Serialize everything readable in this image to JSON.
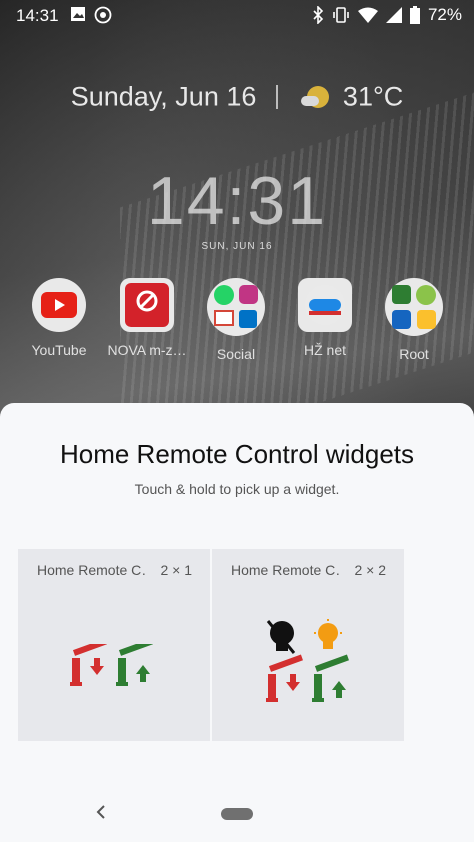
{
  "status_bar": {
    "time": "14:31",
    "battery": "72%",
    "left_icons": [
      "image-icon",
      "whatsapp-icon"
    ],
    "right_icons": [
      "bluetooth-icon",
      "vibrate-icon",
      "wifi-icon",
      "signal-icon",
      "battery-icon"
    ]
  },
  "home": {
    "date": "Sunday, Jun 16",
    "temperature": "31°C",
    "clock_time": "14:31",
    "clock_date": "SUN, JUN 16",
    "apps": [
      {
        "label": "YouTube",
        "icon": "youtube-icon"
      },
      {
        "label": "NOVA m-z…",
        "icon": "nova-icon"
      },
      {
        "label": "Social",
        "icon": "social-folder-icon"
      },
      {
        "label": "HŽ net",
        "icon": "train-icon"
      },
      {
        "label": "Root",
        "icon": "root-folder-icon"
      }
    ]
  },
  "sheet": {
    "title": "Home Remote Control widgets",
    "subtitle": "Touch & hold to pick up a widget.",
    "widgets": [
      {
        "name": "Home Remote C…",
        "size": "2 × 1"
      },
      {
        "name": "Home Remote C…",
        "size": "2 × 2"
      }
    ]
  },
  "colors": {
    "red": "#d32f2f",
    "green": "#2e7d32",
    "amber": "#f39c12"
  }
}
